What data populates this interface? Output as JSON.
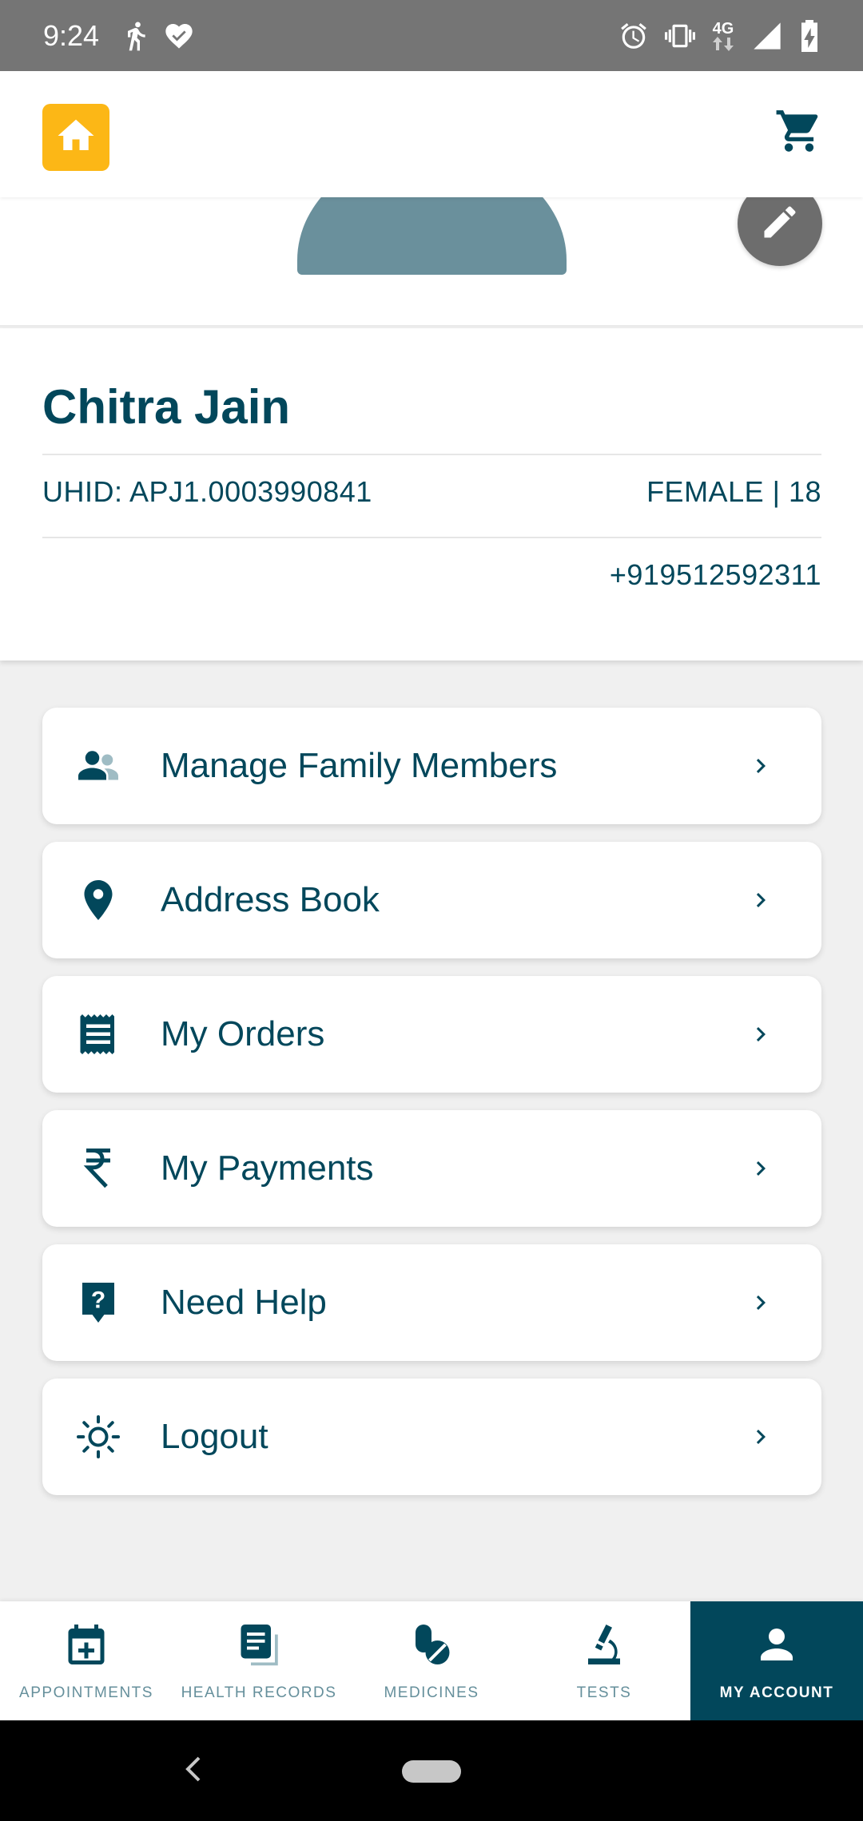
{
  "status_bar": {
    "time": "9:24",
    "network": "4G",
    "left_icons": [
      "running-shoe-icon",
      "heart-check-icon"
    ],
    "right_icons": [
      "alarm-icon",
      "vibrate-icon",
      "network-4g-icon",
      "signal-icon",
      "battery-charging-icon"
    ]
  },
  "header": {
    "home_icon": "home-icon",
    "cart_icon": "cart-icon",
    "accent_color": "#fcb716"
  },
  "profile": {
    "name": "Chitra Jain",
    "uhid": "UHID: APJ1.0003990841",
    "gender_age": "FEMALE | 18",
    "phone": "+919512592311",
    "edit_icon": "pencil-icon"
  },
  "menu": {
    "items": [
      {
        "label": "Manage Family Members",
        "icon": "family-icon"
      },
      {
        "label": "Address Book",
        "icon": "location-pin-icon"
      },
      {
        "label": "My Orders",
        "icon": "receipt-icon"
      },
      {
        "label": "My Payments",
        "icon": "rupee-icon"
      },
      {
        "label": "Need Help",
        "icon": "help-icon"
      },
      {
        "label": "Logout",
        "icon": "logout-icon"
      }
    ]
  },
  "bottom_nav": {
    "tabs": [
      {
        "label": "APPOINTMENTS",
        "icon": "calendar-plus-icon"
      },
      {
        "label": "HEALTH RECORDS",
        "icon": "records-icon"
      },
      {
        "label": "MEDICINES",
        "icon": "pills-icon"
      },
      {
        "label": "TESTS",
        "icon": "microscope-icon"
      },
      {
        "label": "MY ACCOUNT",
        "icon": "person-icon",
        "active": true
      }
    ],
    "active_color": "#02475b"
  },
  "colors": {
    "primary": "#02475b",
    "muted": "#658f9b",
    "background": "#f0f0f0"
  }
}
